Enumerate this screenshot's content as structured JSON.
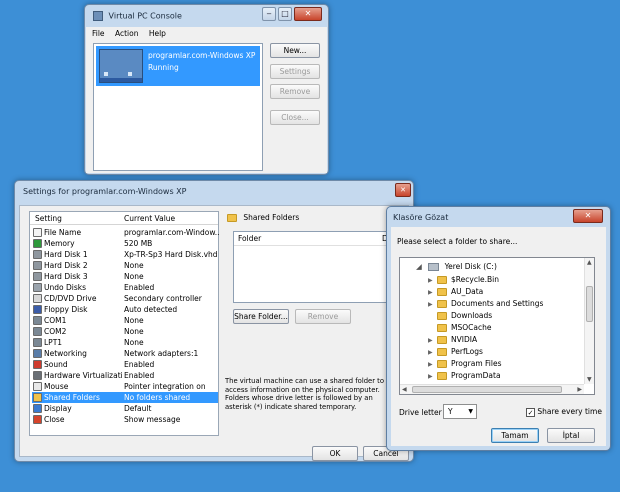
{
  "vpc": {
    "title": "Virtual PC Console",
    "menu": [
      "File",
      "Action",
      "Help"
    ],
    "vm_name": "programlar.com-Windows XP",
    "vm_status": "Running",
    "buttons": {
      "new": "New...",
      "settings": "Settings",
      "remove": "Remove",
      "close": "Close..."
    }
  },
  "settings": {
    "title": "Settings for programlar.com-Windows XP",
    "col_setting": "Setting",
    "col_value": "Current Value",
    "items": [
      {
        "name": "File Name",
        "value": "programlar.com-Window...",
        "icon": "file-icon"
      },
      {
        "name": "Memory",
        "value": "520 MB",
        "icon": "memory-icon"
      },
      {
        "name": "Hard Disk 1",
        "value": "Xp-TR-Sp3 Hard Disk.vhd",
        "icon": "hard-disk-icon"
      },
      {
        "name": "Hard Disk 2",
        "value": "None",
        "icon": "hard-disk-icon"
      },
      {
        "name": "Hard Disk 3",
        "value": "None",
        "icon": "hard-disk-icon"
      },
      {
        "name": "Undo Disks",
        "value": "Enabled",
        "icon": "undo-disk-icon"
      },
      {
        "name": "CD/DVD Drive",
        "value": "Secondary controller",
        "icon": "cd-icon"
      },
      {
        "name": "Floppy Disk",
        "value": "Auto detected",
        "icon": "floppy-icon"
      },
      {
        "name": "COM1",
        "value": "None",
        "icon": "port-icon"
      },
      {
        "name": "COM2",
        "value": "None",
        "icon": "port-icon"
      },
      {
        "name": "LPT1",
        "value": "None",
        "icon": "port-icon"
      },
      {
        "name": "Networking",
        "value": "Network adapters:1",
        "icon": "network-icon"
      },
      {
        "name": "Sound",
        "value": "Enabled",
        "icon": "sound-icon"
      },
      {
        "name": "Hardware Virtualization",
        "value": "Enabled",
        "icon": "chip-icon"
      },
      {
        "name": "Mouse",
        "value": "Pointer integration on",
        "icon": "mouse-icon"
      },
      {
        "name": "Shared Folders",
        "value": "No folders shared",
        "icon": "folder-icon"
      },
      {
        "name": "Display",
        "value": "Default",
        "icon": "display-icon"
      },
      {
        "name": "Close",
        "value": "Show message",
        "icon": "close-icon"
      }
    ],
    "selected_index": 15,
    "section_title": "Shared Folders",
    "folder_col": "Folder",
    "folder_col2": "D",
    "share_button": "Share Folder...",
    "remove_button": "Remove",
    "description": "The virtual machine can use a shared folder to access information on the physical computer. Folders whose drive letter is followed by an asterisk (*) indicate shared temporary.",
    "ok": "OK",
    "cancel": "Cancel"
  },
  "browse": {
    "title": "Klasöre Gözat",
    "prompt": "Please select a folder to share...",
    "root": "Yerel Disk (C:)",
    "folders": [
      "$Recycle.Bin",
      "AU_Data",
      "Documents and Settings",
      "Downloads",
      "MSOCache",
      "NVIDIA",
      "PerfLogs",
      "Program Files",
      "ProgramData"
    ],
    "drive_label": "Drive letter",
    "drive_value": "Y",
    "share_every_time": "Share every time",
    "ok": "Tamam",
    "cancel": "İptal"
  }
}
